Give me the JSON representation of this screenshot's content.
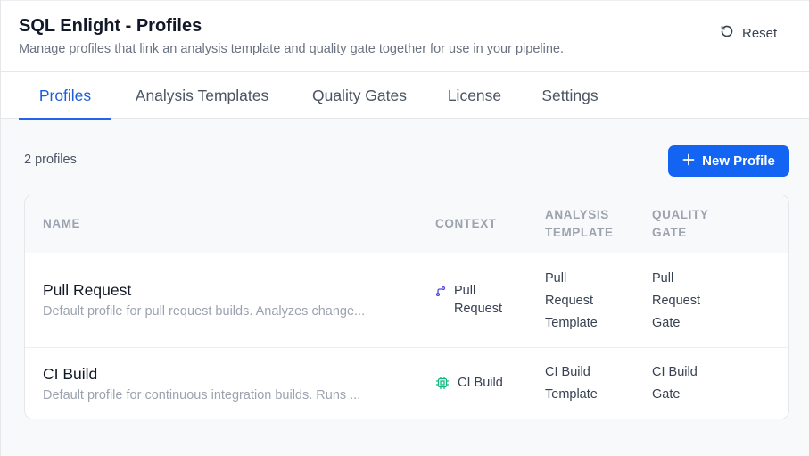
{
  "header": {
    "title": "SQL Enlight - Profiles",
    "subtitle": "Manage profiles that link an analysis template and quality gate together for use in your pipeline.",
    "reset_label": "Reset"
  },
  "tabs": [
    {
      "label": "Profiles",
      "active": true
    },
    {
      "label": "Analysis Templates",
      "active": false
    },
    {
      "label": "Quality Gates",
      "active": false
    },
    {
      "label": "License",
      "active": false
    },
    {
      "label": "Settings",
      "active": false
    }
  ],
  "toolbar": {
    "count_label": "2 profiles",
    "new_button_label": "New Profile"
  },
  "table": {
    "columns": {
      "name": "NAME",
      "context": "CONTEXT",
      "analysis_template_line1": "ANALYSIS",
      "analysis_template_line2": "TEMPLATE",
      "quality_gate_line1": "QUALITY",
      "quality_gate_line2": "GATE"
    },
    "rows": [
      {
        "name": "Pull Request",
        "description": "Default profile for pull request builds. Analyzes change...",
        "context_icon": "git-branch-icon",
        "context_line1": "Pull",
        "context_line2": "Request",
        "template_line1": "Pull",
        "template_line2": "Request",
        "template_line3": "Template",
        "gate_line1": "Pull",
        "gate_line2": "Request",
        "gate_line3": "Gate"
      },
      {
        "name": "CI Build",
        "description": "Default profile for continuous integration builds. Runs ...",
        "context_icon": "cpu-icon",
        "context_line1": "CI Build",
        "template_line1": "CI Build",
        "template_line2": "Template",
        "gate_line1": "CI Build",
        "gate_line2": "Gate"
      }
    ]
  },
  "colors": {
    "accent": "#1464f4",
    "tab_active": "#1d5ed8",
    "muted": "#9ca3af",
    "context_icon_pr": "#4f46e5",
    "context_icon_ci": "#10b981"
  }
}
